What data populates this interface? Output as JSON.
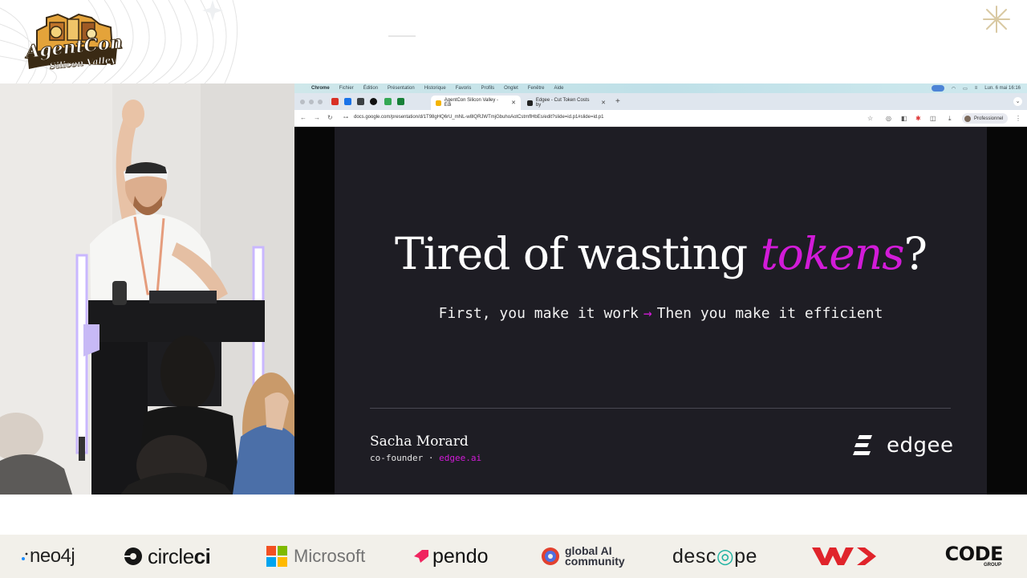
{
  "event": {
    "logo_title": "AgentCon",
    "logo_subtitle": "Silicon Valley"
  },
  "menubar": {
    "items": [
      "Chrome",
      "Fichier",
      "Édition",
      "Présentation",
      "Historique",
      "Favoris",
      "Profils",
      "Onglet",
      "Fenêtre",
      "Aide"
    ],
    "clock": "Lun. 6 mai 16:16"
  },
  "browser": {
    "tabs": [
      {
        "label": "AgentCon Silicon Valley - Édi",
        "active": true
      },
      {
        "label": "Edgee - Cut Token Costs by",
        "active": false
      }
    ],
    "new_tab": "+",
    "url": "docs.google.com/presentation/d/1T98gHQ6rU_mNL-w8lQRJWTmjGbuhoAotCstmflHbEs/edit?slide=id.p1#slide=id.p1",
    "profile": "Professionnel"
  },
  "slide": {
    "title_before": "Tired of wasting ",
    "title_highlight": "tokens",
    "title_after": "?",
    "subtitle_left": "First, you make it work",
    "subtitle_arrow": "→",
    "subtitle_right": "Then you make it efficient",
    "presenter_name": "Sacha Morard",
    "presenter_role": "co-founder · ",
    "presenter_link": "edgee.ai",
    "brand": "edgee",
    "accent_color": "#d21bd8"
  },
  "sponsors": {
    "neo4j": "neo4j",
    "circleci_a": "circle",
    "circleci_b": "ci",
    "microsoft": "Microsoft",
    "pendo": "pendo",
    "global_ai_line1": "global AI",
    "global_ai_line2": "community",
    "descope_a": "de",
    "descope_b": "sc",
    "descope_c": "pe",
    "code": "CODE",
    "code_sub": "GROUP"
  }
}
